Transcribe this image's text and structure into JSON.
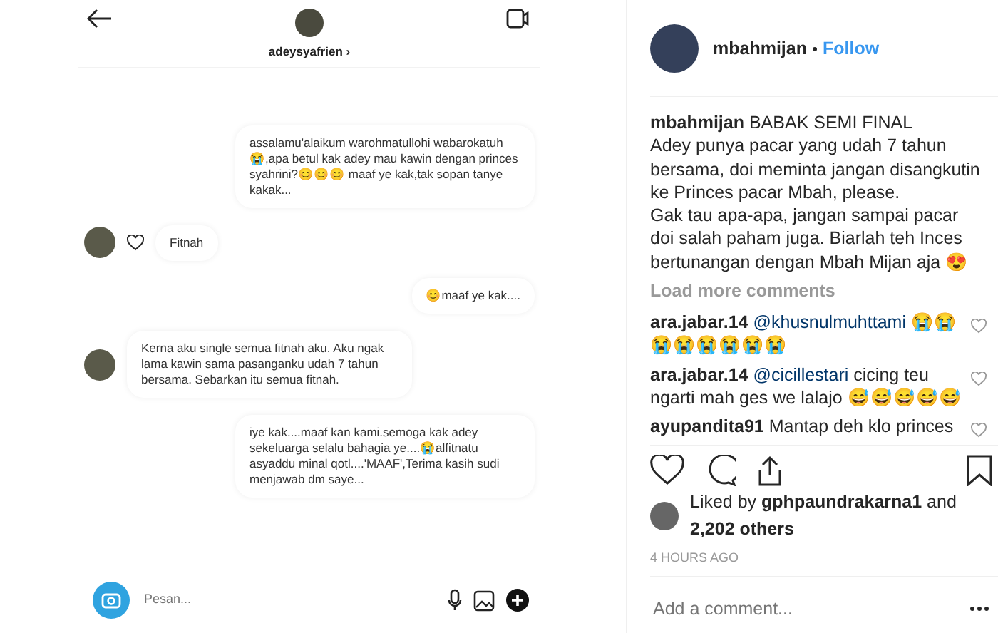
{
  "dm_screen": {
    "username": "adeysyafrien",
    "chevron": "›",
    "messages": [
      {
        "kind": "sent",
        "text": "assalamu'alaikum warohmatullohi wabarokatuh😭,apa betul kak adey mau kawin dengan princes syahrini?😊😊😊 maaf ye kak,tak sopan tanye kakak..."
      },
      {
        "kind": "received",
        "text": "Fitnah",
        "liked": true
      },
      {
        "kind": "sent",
        "text": "😊maaf ye kak...."
      },
      {
        "kind": "received",
        "text": "Kerna aku single semua fitnah aku. Aku ngak lama kawin sama pasanganku udah 7 tahun bersama. Sebarkan itu semua fitnah.",
        "liked": false
      },
      {
        "kind": "sent",
        "text": "iye kak....maaf kan kami.semoga kak adey sekeluarga selalu bahagia ye....😭alfitnatu asyaddu minal qotl....'MAAF',Terima kasih sudi menjawab dm saye..."
      }
    ],
    "composer": {
      "placeholder": "Pesan..."
    }
  },
  "post": {
    "author": "mbahmijan",
    "follow": "Follow",
    "caption": {
      "author": "mbahmijan",
      "text": "BABAK SEMI FINAL\nAdey punya pacar yang udah 7 tahun bersama, doi meminta jangan disangkutin ke Princes pacar Mbah, please.\nGak tau apa-apa, jangan sampai pacar doi salah paham juga. Biarlah teh Inces bertunangan dengan Mbah Mijan aja 😍"
    },
    "load_more": "Load more comments",
    "comments": [
      {
        "user": "ara.jabar.14",
        "mention": "@khusnulmuhttami",
        "text": "😭😭😭😭😭😭😭😭"
      },
      {
        "user": "ara.jabar.14",
        "mention": "@cicillestari",
        "text": "cicing teu ngarti mah ges we lalajo 😅😅😅😅😅"
      },
      {
        "user": "ayupandita91",
        "text": "Mantap deh klo princes"
      }
    ],
    "likes": "Liked by **gphpaundrakarna1** and **2,202 others**",
    "time": "4 HOURS AGO",
    "add_comment": {
      "placeholder": "Add a comment..."
    }
  }
}
